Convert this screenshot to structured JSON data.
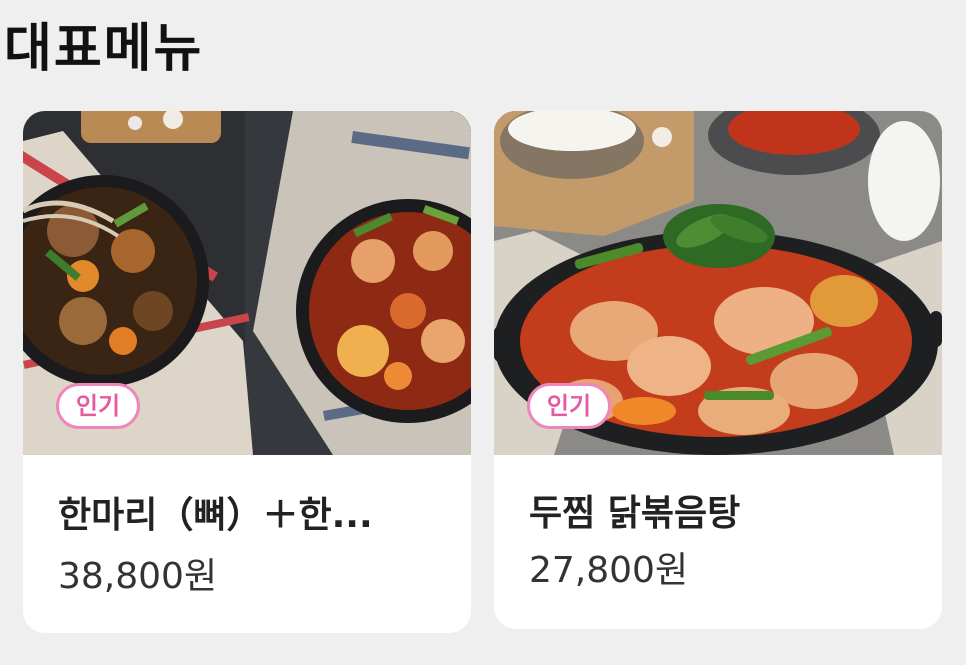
{
  "section": {
    "title": "대표메뉴"
  },
  "menu_items": [
    {
      "name": "한마리（뼈）＋한...",
      "price": "38,800원",
      "badge": "인기",
      "image": "two-bowls-braised-chicken-photo"
    },
    {
      "name": "두찜 닭볶음탕",
      "price": "27,800원",
      "badge": "인기",
      "image": "spicy-braised-chicken-stew-pot-photo"
    }
  ],
  "colors": {
    "background": "#efefef",
    "card": "#ffffff",
    "badge_text": "#e55aa2",
    "badge_border": "#ef86bb",
    "text_primary": "#222222"
  }
}
